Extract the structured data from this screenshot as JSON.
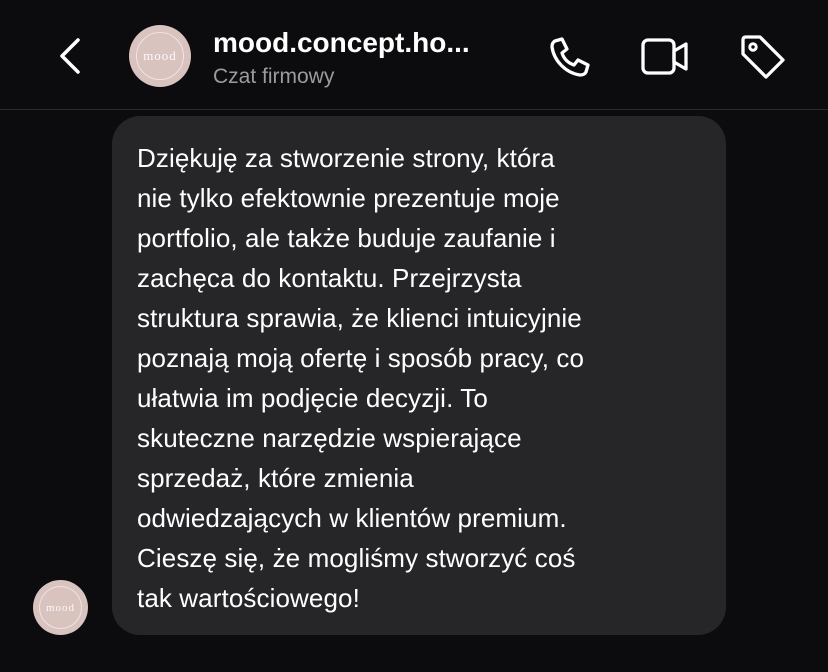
{
  "header": {
    "contact_name": "mood.concept.ho...",
    "contact_subtitle": "Czat firmowy",
    "avatar_logo": "mood",
    "back_icon": "chevron-left-icon",
    "call_icon": "phone-icon",
    "video_icon": "video-camera-icon",
    "label_icon": "tag-icon"
  },
  "message": {
    "text": "Dziękuję za stworzenie strony, która\nnie tylko efektownie prezentuje moje\nportfolio, ale także buduje zaufanie i\nzachęca do kontaktu. Przejrzysta\nstruktura sprawia, że klienci intuicyjnie\npoznają moją ofertę i sposób pracy, co\nułatwia im podjęcie decyzji. To\nskuteczne narzędzie wspierające\nsprzedaż, które zmienia\nodwiedzających w klientów premium.\nCieszę się, że mogliśmy stworzyć coś\ntak wartościowego!",
    "sender_avatar_logo": "mood"
  },
  "colors": {
    "background": "#0c0c0e",
    "bubble": "#262629",
    "subtitle": "#9a9aa0",
    "avatar": "#d8c3bf"
  }
}
